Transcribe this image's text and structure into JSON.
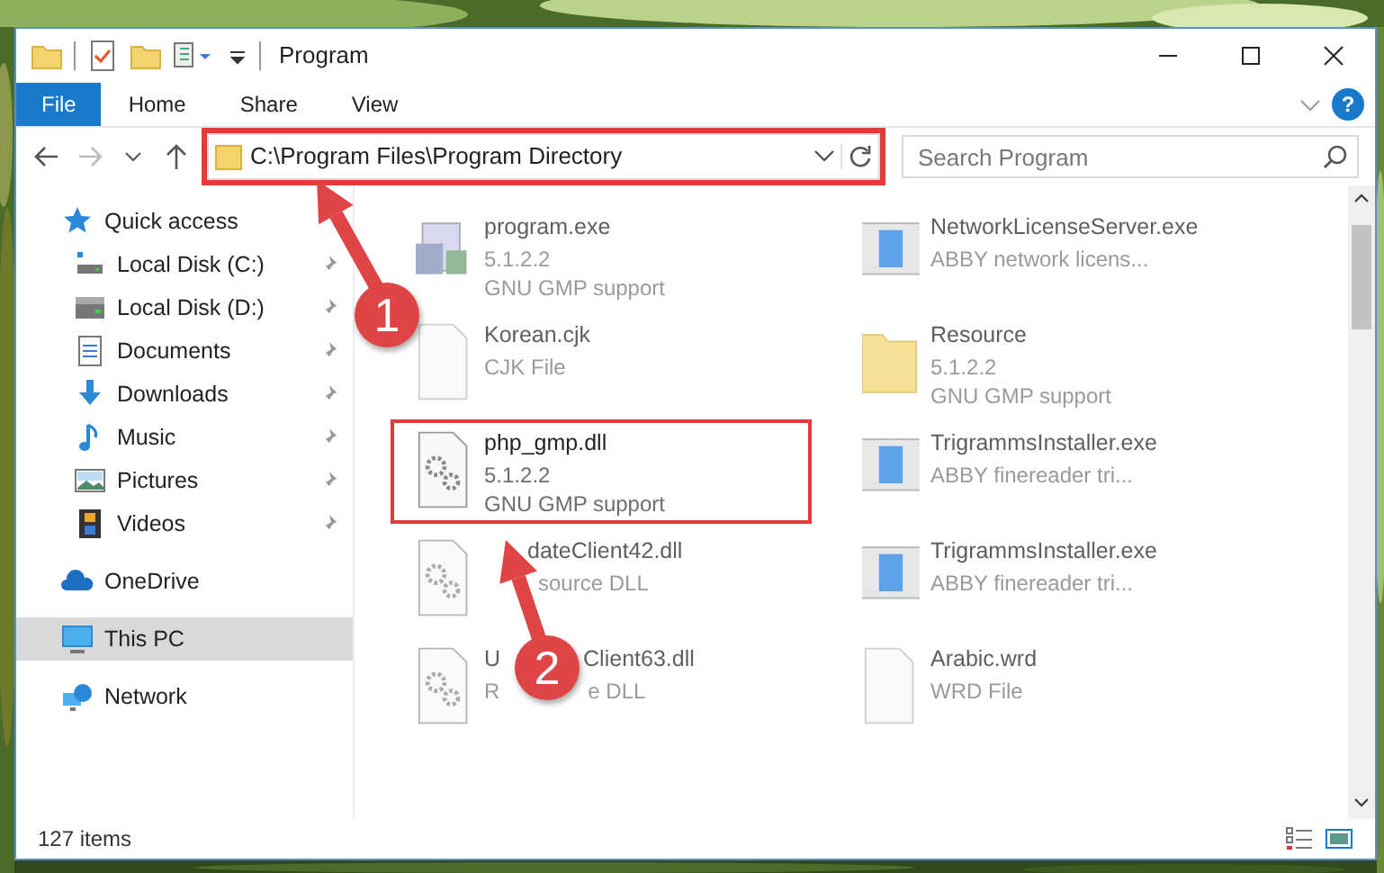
{
  "window": {
    "title": "Program"
  },
  "ribbon": {
    "tabs": [
      {
        "label": "File",
        "selected": true
      },
      {
        "label": "Home",
        "selected": false
      },
      {
        "label": "Share",
        "selected": false
      },
      {
        "label": "View",
        "selected": false
      }
    ],
    "help": "?"
  },
  "address_bar": {
    "path": "C:\\Program Files\\Program Directory",
    "highlighted": true,
    "forward_disabled": true
  },
  "search": {
    "placeholder": "Search Program"
  },
  "sidebar": {
    "items": [
      {
        "label": "Quick access",
        "selected": false,
        "children": [
          {
            "label": "Local Disk (C:)",
            "pinned": true
          },
          {
            "label": "Local Disk (D:)",
            "pinned": true
          },
          {
            "label": "Documents",
            "pinned": true
          },
          {
            "label": "Downloads",
            "pinned": true
          },
          {
            "label": "Music",
            "pinned": true
          },
          {
            "label": "Pictures",
            "pinned": true
          },
          {
            "label": "Videos",
            "pinned": true
          }
        ]
      },
      {
        "label": "OneDrive",
        "selected": false
      },
      {
        "label": "This PC",
        "selected": true
      },
      {
        "label": "Network",
        "selected": false
      }
    ]
  },
  "files": [
    {
      "kind": "exe",
      "name": "program.exe",
      "lines": [
        "5.1.2.2",
        "GNU GMP support"
      ],
      "blurred": true,
      "highlighted": false
    },
    {
      "kind": "app",
      "name": "NetworkLicenseServer.exe",
      "lines": [
        "ABBY network licens..."
      ],
      "blurred": true,
      "highlighted": false
    },
    {
      "kind": "file",
      "name": "Korean.cjk",
      "lines": [
        "CJK File"
      ],
      "blurred": true,
      "highlighted": false
    },
    {
      "kind": "folder",
      "name": "Resource",
      "lines": [
        "5.1.2.2",
        "GNU GMP support"
      ],
      "blurred": true,
      "highlighted": false
    },
    {
      "kind": "dll",
      "name": "php_gmp.dll",
      "lines": [
        "5.1.2.2",
        "GNU GMP support"
      ],
      "blurred": false,
      "highlighted": true
    },
    {
      "kind": "app",
      "name": "TrigrammsInstaller.exe",
      "lines": [
        "ABBY finereader tri..."
      ],
      "blurred": true,
      "highlighted": false
    },
    {
      "kind": "dll",
      "name": "dateClient42.dll",
      "lines": [
        "source DLL"
      ],
      "blurred": true,
      "highlighted": false
    },
    {
      "kind": "app",
      "name": "TrigrammsInstaller.exe",
      "lines": [
        "ABBY finereader tri..."
      ],
      "blurred": true,
      "highlighted": false
    },
    {
      "kind": "dll",
      "name": "U",
      "name_rest": "Client63.dll",
      "lines": [
        "R"
      ],
      "line_rest": "e DLL",
      "blurred": true,
      "highlighted": false
    },
    {
      "kind": "file",
      "name": "Arabic.wrd",
      "lines": [
        "WRD File"
      ],
      "blurred": true,
      "highlighted": false
    }
  ],
  "status_bar": {
    "count": "127 items"
  },
  "annotations": [
    {
      "label": "1"
    },
    {
      "label": "2"
    }
  ]
}
